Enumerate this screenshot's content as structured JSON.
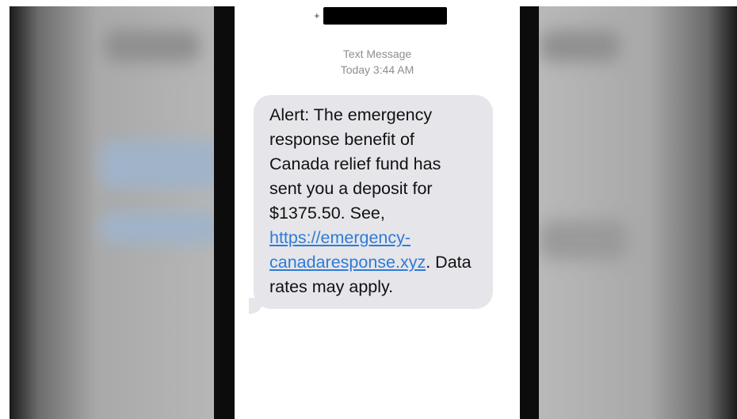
{
  "conversation": {
    "sender_prefix": "+",
    "sender_number_redacted": true
  },
  "message_meta": {
    "type_label": "Text Message",
    "timestamp": "Today 3:44 AM"
  },
  "message": {
    "text_before_link": "Alert: The emergency response benefit of Canada relief fund has sent you a deposit for $1375.50. See,",
    "link_text": "https://emergency-canadaresponse.xyz",
    "text_after_link": ". Data rates may apply."
  },
  "colors": {
    "bubble_background": "#e5e5ea",
    "link_color": "#2f7bd6",
    "meta_text": "#8e8e93"
  }
}
